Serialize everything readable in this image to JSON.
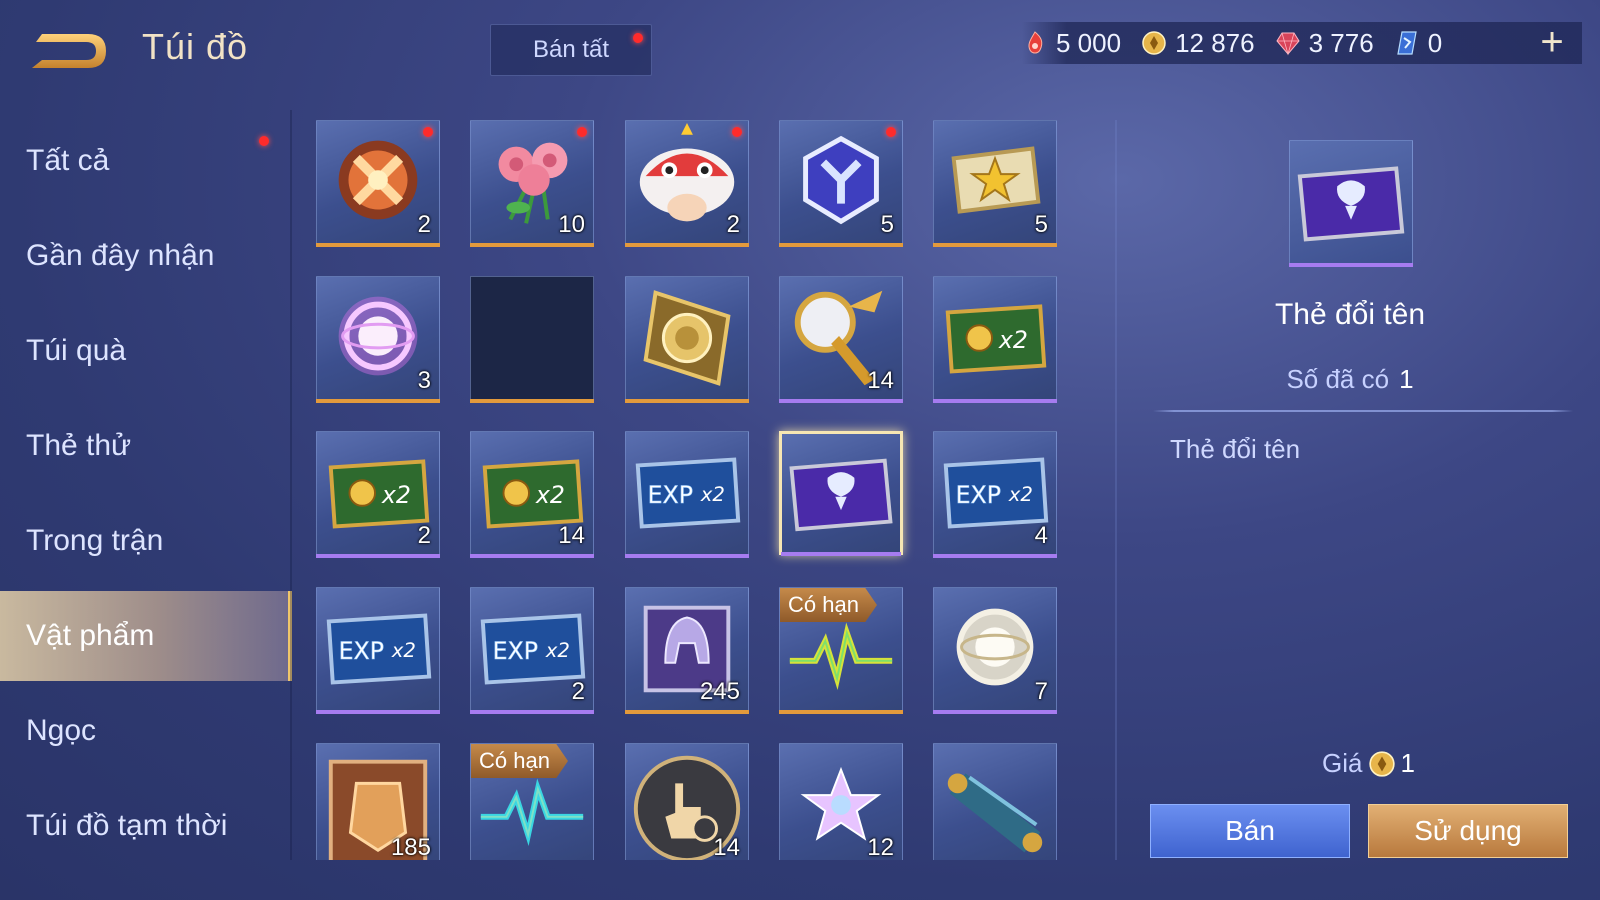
{
  "header": {
    "title": "Túi đồ",
    "sell_all_label": "Bán tất",
    "currencies": [
      {
        "name": "red-coupon",
        "value": "5 000",
        "color": "#e8403a"
      },
      {
        "name": "gold-coin",
        "value": "12 876",
        "color": "#e7b54a"
      },
      {
        "name": "ruby",
        "value": "3 776",
        "color": "#d9445a"
      },
      {
        "name": "crystal",
        "value": "0",
        "color": "#5ab6ff"
      }
    ],
    "plus_label": "+"
  },
  "sidebar": {
    "items": [
      {
        "label": "Tất cả"
      },
      {
        "label": "Gần đây nhận"
      },
      {
        "label": "Túi quà"
      },
      {
        "label": "Thẻ thử"
      },
      {
        "label": "Trong trận"
      },
      {
        "label": "Vật phẩm"
      },
      {
        "label": "Ngọc"
      },
      {
        "label": "Túi đồ tạm thời"
      }
    ],
    "active_index": 5
  },
  "grid": {
    "items": [
      {
        "icon": "fire-orb-icon",
        "qty": "2",
        "rarity": "orange",
        "new": true
      },
      {
        "icon": "rose-bouquet-icon",
        "qty": "10",
        "rarity": "orange",
        "new": true
      },
      {
        "icon": "lion-dance-head-icon",
        "qty": "2",
        "rarity": "orange",
        "new": true
      },
      {
        "icon": "blue-star-badge-icon",
        "qty": "5",
        "rarity": "orange",
        "new": true
      },
      {
        "icon": "gold-star-ticket-icon",
        "qty": "5",
        "rarity": "orange",
        "new": false
      },
      {
        "icon": "purple-sphere-icon",
        "qty": "3",
        "rarity": "orange",
        "new": false
      },
      {
        "icon": "empty-slot",
        "qty": "",
        "rarity": "orange",
        "new": false
      },
      {
        "icon": "gold-medallion-card-icon",
        "qty": "",
        "rarity": "orange",
        "new": false
      },
      {
        "icon": "golden-horn-icon",
        "qty": "14",
        "rarity": "purple",
        "new": false
      },
      {
        "icon": "gold-x2-card-icon",
        "qty": "",
        "rarity": "purple",
        "new": false
      },
      {
        "icon": "gold-x2-card-icon",
        "qty": "2",
        "rarity": "purple",
        "new": false
      },
      {
        "icon": "gold-x2-card-icon",
        "qty": "14",
        "rarity": "purple",
        "new": false
      },
      {
        "icon": "exp-x2-card-icon",
        "qty": "",
        "rarity": "purple",
        "new": false
      },
      {
        "icon": "rename-card-icon",
        "qty": "",
        "rarity": "purple",
        "new": false,
        "selected": true
      },
      {
        "icon": "exp-x2-card-icon",
        "qty": "4",
        "rarity": "purple",
        "new": false
      },
      {
        "icon": "exp-x2-card-icon",
        "qty": "",
        "rarity": "purple",
        "new": false
      },
      {
        "icon": "exp-x2-card-icon",
        "qty": "2",
        "rarity": "purple",
        "new": false
      },
      {
        "icon": "helmet-card-icon",
        "qty": "245",
        "rarity": "orange",
        "new": false
      },
      {
        "icon": "pulse-wave-icon",
        "qty": "",
        "rarity": "orange",
        "new": false,
        "limited": "Có hạn"
      },
      {
        "icon": "white-sphere-icon",
        "qty": "7",
        "rarity": "purple",
        "new": false
      },
      {
        "icon": "armor-card-icon",
        "qty": "185",
        "rarity": "orange",
        "new": false
      },
      {
        "icon": "pulse-wave-blue-icon",
        "qty": "",
        "rarity": "orange",
        "new": false,
        "limited": "Có hạn"
      },
      {
        "icon": "touch-hand-icon",
        "qty": "14",
        "rarity": "orange",
        "new": false
      },
      {
        "icon": "crystal-star-icon",
        "qty": "12",
        "rarity": "orange",
        "new": false
      },
      {
        "icon": "scroll-icon",
        "qty": "",
        "rarity": "orange",
        "new": false
      }
    ]
  },
  "detail": {
    "icon": "rename-card-icon",
    "name": "Thẻ đổi tên",
    "owned_label": "Số đã có",
    "owned_value": "1",
    "description": "Thẻ đổi tên",
    "price_label": "Giá",
    "price_value": "1",
    "sell_label": "Bán",
    "use_label": "Sử dụng"
  }
}
